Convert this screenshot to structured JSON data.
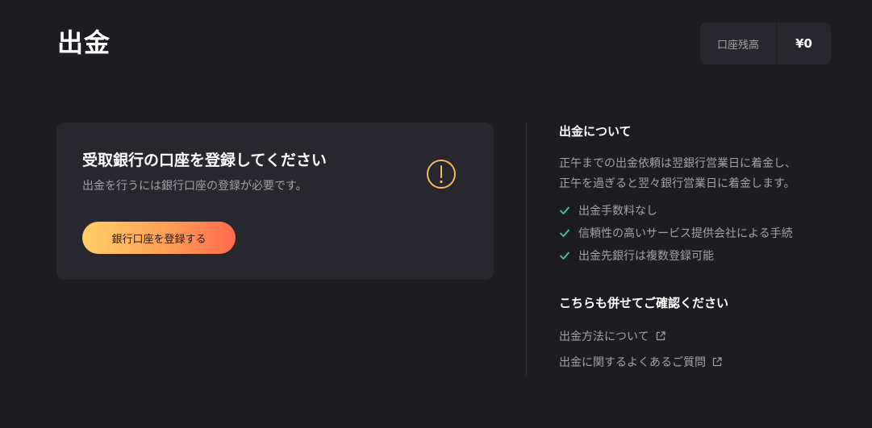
{
  "header": {
    "title": "出金",
    "balance_label": "口座残高",
    "balance_value": "¥0"
  },
  "notice": {
    "title": "受取銀行の口座を登録してください",
    "description": "出金を行うには銀行口座の登録が必要です。",
    "icon": "warning-icon",
    "button_label": "銀行口座を登録する",
    "icon_color": "#f3b95f",
    "button_gradient": [
      "#ffd068",
      "#ff6a4d"
    ]
  },
  "info": {
    "heading": "出金について",
    "text_line1": "正午までの出金依頼は翌銀行営業日に着金し、",
    "text_line2": "正午を過ぎると翌々銀行営業日に着金します。",
    "features": [
      "出金手数料なし",
      "信頼性の高いサービス提供会社による手続",
      "出金先銀行は複数登録可能"
    ],
    "check_color": "#3ecf8e"
  },
  "related": {
    "heading": "こちらも併せてご確認ください",
    "links": [
      "出金方法について",
      "出金に関するよくあるご質問"
    ]
  }
}
